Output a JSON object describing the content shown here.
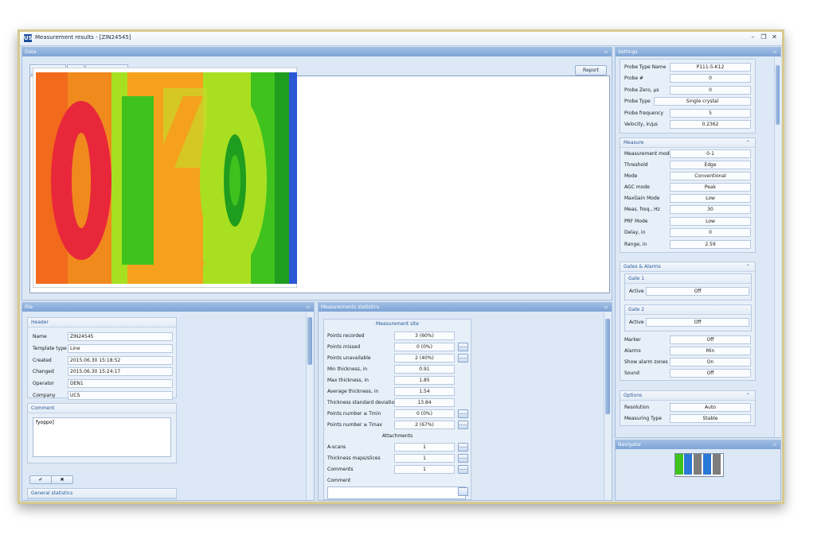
{
  "window": {
    "title": "Measurement results - [ZIN24545]",
    "controls": [
      "–",
      "❐",
      "✕"
    ],
    "app_icon": "US"
  },
  "data_panel": {
    "title": "Data",
    "tabs": [
      "",
      "",
      ""
    ],
    "report_button": "Report",
    "thickness_map": {
      "palette": {
        "orange": "#f26a1b",
        "red": "#e8283a",
        "yellow_orange": "#f5a11d",
        "yellow_green": "#a8e021",
        "green": "#3fc21e",
        "dark_green": "#1f9d1e",
        "blue": "#2a57d6"
      }
    }
  },
  "file_panel": {
    "title": "File",
    "header_group": {
      "title": "Header",
      "rows": [
        {
          "label": "Name",
          "value": "ZIN24545"
        },
        {
          "label": "Template type",
          "value": "Line"
        },
        {
          "label": "Created",
          "value": "2015.06.30 15:18:52"
        },
        {
          "label": "Changed",
          "value": "2015.06.30 15:24:17"
        },
        {
          "label": "Operator",
          "value": "DEN1"
        },
        {
          "label": "Company",
          "value": "UCS"
        }
      ]
    },
    "comment_group": {
      "title": "Comment",
      "text": "fyoppo]"
    },
    "ok_button": "✔",
    "cancel_button": "✖",
    "general_statistics": "General statistics"
  },
  "stats_panel": {
    "title": "Measurements statistics",
    "section": "Measurement site",
    "rows": [
      {
        "label": "Points recorded",
        "value": "3 (60%)",
        "dots": false
      },
      {
        "label": "Points missed",
        "value": "0 (0%)",
        "dots": true
      },
      {
        "label": "Points unavailable",
        "value": "2 (40%)",
        "dots": true
      },
      {
        "label": "Min thickness, in",
        "value": "0.91",
        "dots": false
      },
      {
        "label": "Max thickness, in",
        "value": "1.85",
        "dots": false
      },
      {
        "label": "Average thickness, in",
        "value": "1.54",
        "dots": false
      },
      {
        "label": "Thickness standard deviation",
        "value": "13.84",
        "dots": false
      },
      {
        "label": "Points number ≤ Tmin",
        "value": "0 (0%)",
        "dots": true
      },
      {
        "label": "Points number ≥ Tmax",
        "value": "2 (67%)",
        "dots": true
      }
    ],
    "attachments_title": "Attachments",
    "attachments": [
      {
        "label": "A-scans",
        "value": "1"
      },
      {
        "label": "Thickness maps/slices",
        "value": "1"
      },
      {
        "label": "Comments",
        "value": "1"
      }
    ],
    "comment_label": "Comment",
    "dots_label": "....."
  },
  "settings_panel": {
    "title": "Settings",
    "probe": [
      {
        "label": "Probe Type Name",
        "value": "P111-5-K12"
      },
      {
        "label": "Probe #",
        "value": "0"
      },
      {
        "label": "Probe Zero, µs",
        "value": "0"
      },
      {
        "label": "Probe Type",
        "value": "Single crystal"
      },
      {
        "label": "Probe frequency",
        "value": "5"
      },
      {
        "label": "Velocity, in/µs",
        "value": "0.2362"
      }
    ],
    "measure": {
      "title": "Measure",
      "rows": [
        {
          "label": "Measurement mode",
          "value": "0-1"
        },
        {
          "label": "Threshold",
          "value": "Edge"
        },
        {
          "label": "Mode",
          "value": "Conventional"
        },
        {
          "label": "AGC mode",
          "value": "Peak"
        },
        {
          "label": "MaxGain Mode",
          "value": "Low"
        },
        {
          "label": "Meas. freq., Hz",
          "value": "30"
        },
        {
          "label": "PRF Mode",
          "value": "Low"
        },
        {
          "label": "Delay, in",
          "value": "0"
        },
        {
          "label": "Range, in",
          "value": "2.59"
        }
      ]
    },
    "gates": {
      "title": "Gates & Alarms",
      "gate1": {
        "title": "Gate 1",
        "label": "Active",
        "value": "Off"
      },
      "gate2": {
        "title": "Gate 2",
        "label": "Active",
        "value": "Off"
      },
      "rows": [
        {
          "label": "Marker",
          "value": "Off"
        },
        {
          "label": "Alarms",
          "value": "Min"
        },
        {
          "label": "Show alarm zones",
          "value": "On"
        },
        {
          "label": "Sound",
          "value": "Off"
        }
      ]
    },
    "options": {
      "title": "Options",
      "rows": [
        {
          "label": "Resolution",
          "value": "Auto"
        },
        {
          "label": "Measuring Type",
          "value": "Stable"
        }
      ]
    }
  },
  "navigator_panel": {
    "title": "Navigator",
    "colors": [
      "#3fc21e",
      "#2a78d6",
      "#7d7d7d",
      "#2a78d6",
      "#7d7d7d"
    ]
  },
  "chevron": "⌃",
  "pin": "▫"
}
